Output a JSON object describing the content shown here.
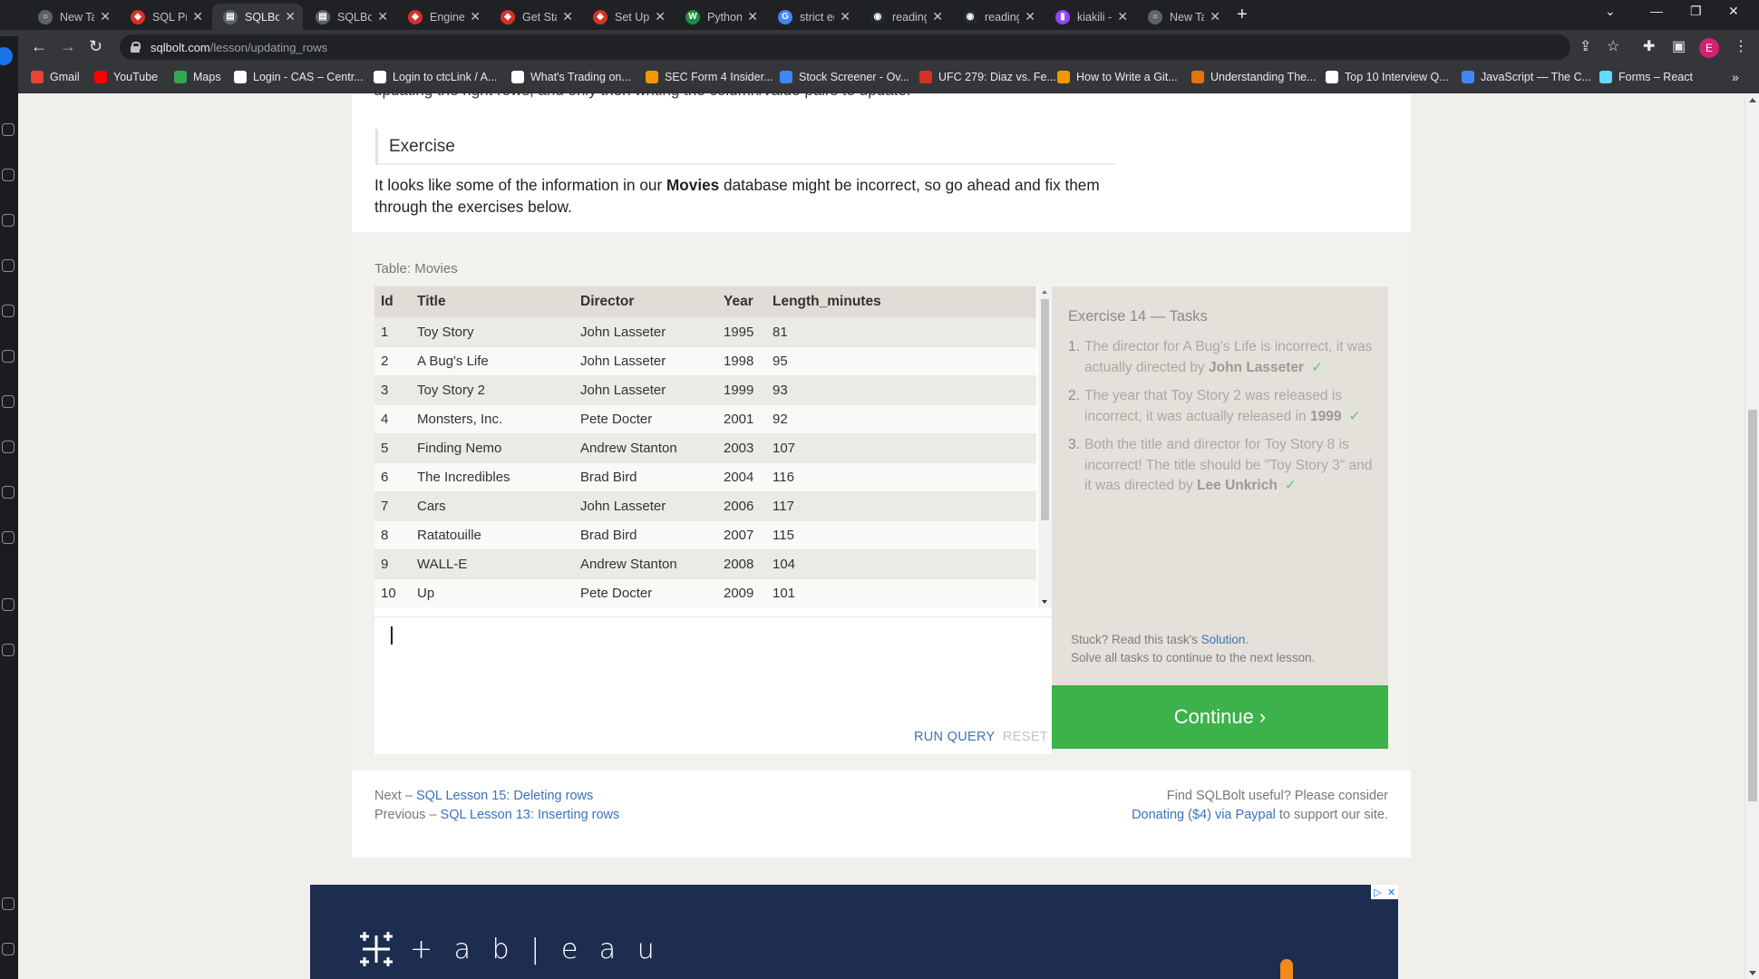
{
  "browser": {
    "tabs": [
      {
        "title": "New Tab",
        "color": "#5f6368",
        "glyph": "○"
      },
      {
        "title": "SQL Practic",
        "color": "#d93025",
        "glyph": "◆"
      },
      {
        "title": "SQLBolt - L",
        "color": "#5f6368",
        "glyph": "▤"
      },
      {
        "title": "SQLBolt - L",
        "color": "#5f6368",
        "glyph": "▤"
      },
      {
        "title": "Engineering",
        "color": "#d93025",
        "glyph": "◆"
      },
      {
        "title": "Get Started",
        "color": "#d93025",
        "glyph": "◆"
      },
      {
        "title": "Set Up | co",
        "color": "#d93025",
        "glyph": "◆"
      },
      {
        "title": "Python Ope",
        "color": "#1e8e3e",
        "glyph": "W"
      },
      {
        "title": "strict equal",
        "color": "#4285f4",
        "glyph": "G"
      },
      {
        "title": "reading-no",
        "color": "#24292f",
        "glyph": "◉"
      },
      {
        "title": "reading-no",
        "color": "#24292f",
        "glyph": "◉"
      },
      {
        "title": "kiakili - Twi",
        "color": "#9146ff",
        "glyph": "▮"
      },
      {
        "title": "New Tab",
        "color": "#5f6368",
        "glyph": "○"
      }
    ],
    "active_tab": 2,
    "url_host": "sqlbolt.com",
    "url_path": "/lesson/updating_rows",
    "profile_initial": "E",
    "bookmarks": [
      {
        "label": "Gmail",
        "color": "#ea4335"
      },
      {
        "label": "YouTube",
        "color": "#ff0000"
      },
      {
        "label": "Maps",
        "color": "#34a853"
      },
      {
        "label": "Login - CAS – Centr...",
        "color": "#ffffff"
      },
      {
        "label": "Login to ctcLink / A...",
        "color": "#ffffff"
      },
      {
        "label": "What's Trading on...",
        "color": "#ffffff"
      },
      {
        "label": "SEC Form 4 Insider...",
        "color": "#f29900"
      },
      {
        "label": "Stock Screener - Ov...",
        "color": "#4285f4"
      },
      {
        "label": "UFC 279: Diaz vs. Fe...",
        "color": "#d93025"
      },
      {
        "label": "How to Write a Git...",
        "color": "#f29900"
      },
      {
        "label": "Understanding The...",
        "color": "#e8710a"
      },
      {
        "label": "Top 10 Interview Q...",
        "color": "#ffffff"
      },
      {
        "label": "JavaScript — The C...",
        "color": "#4285f4"
      },
      {
        "label": "Forms – React",
        "color": "#61dafb"
      }
    ]
  },
  "lesson": {
    "cutoff_text": "updating the right rows, and only then writing the column/value pairs to update.",
    "exercise_heading": "Exercise",
    "intro_before": "It looks like some of the information in our ",
    "intro_bold": "Movies",
    "intro_after": " database might be incorrect, so go ahead and fix them through the exercises below."
  },
  "table": {
    "label": "Table: Movies",
    "columns": [
      "Id",
      "Title",
      "Director",
      "Year",
      "Length_minutes"
    ],
    "rows": [
      [
        "1",
        "Toy Story",
        "John Lasseter",
        "1995",
        "81"
      ],
      [
        "2",
        "A Bug's Life",
        "John Lasseter",
        "1998",
        "95"
      ],
      [
        "3",
        "Toy Story 2",
        "John Lasseter",
        "1999",
        "93"
      ],
      [
        "4",
        "Monsters, Inc.",
        "Pete Docter",
        "2001",
        "92"
      ],
      [
        "5",
        "Finding Nemo",
        "Andrew Stanton",
        "2003",
        "107"
      ],
      [
        "6",
        "The Incredibles",
        "Brad Bird",
        "2004",
        "116"
      ],
      [
        "7",
        "Cars",
        "John Lasseter",
        "2006",
        "117"
      ],
      [
        "8",
        "Ratatouille",
        "Brad Bird",
        "2007",
        "115"
      ],
      [
        "9",
        "WALL-E",
        "Andrew Stanton",
        "2008",
        "104"
      ],
      [
        "10",
        "Up",
        "Pete Docter",
        "2009",
        "101"
      ]
    ]
  },
  "editor": {
    "value": "",
    "run_label": "RUN QUERY",
    "reset_label": "RESET"
  },
  "tasks": {
    "title": "Exercise 14 — Tasks",
    "items": [
      {
        "num": "1.",
        "text": "The director for A Bug's Life is incorrect, it was actually directed by ",
        "bold": "John Lasseter",
        "done": true
      },
      {
        "num": "2.",
        "text": "The year that Toy Story 2 was released is incorrect, it was actually released in ",
        "bold": "1999",
        "done": true
      },
      {
        "num": "3.",
        "text": "Both the title and director for Toy Story 8 is incorrect! The title should be \"Toy Story 3\" and it was directed by ",
        "bold": "Lee Unkrich",
        "done": true
      }
    ],
    "check_glyph": "✓",
    "stuck_before": "Stuck? Read this task's ",
    "stuck_link": "Solution",
    "stuck_after": ".",
    "stuck_line2": "Solve all tasks to continue to the next lesson.",
    "continue_label": "Continue ›",
    "continue_color": "#3cb24a"
  },
  "footer": {
    "next_prefix": "Next – ",
    "next_link": "SQL Lesson 15: Deleting rows",
    "prev_prefix": "Previous – ",
    "prev_link": "SQL Lesson 13: Inserting rows",
    "right_line1": "Find SQLBolt useful? Please consider",
    "donate_link": "Donating ($4) via Paypal",
    "right_after": " to support our site."
  },
  "ad": {
    "wordmark": "+ a b | e a u",
    "adchoice_1": "▷",
    "adchoice_2": "✕"
  }
}
